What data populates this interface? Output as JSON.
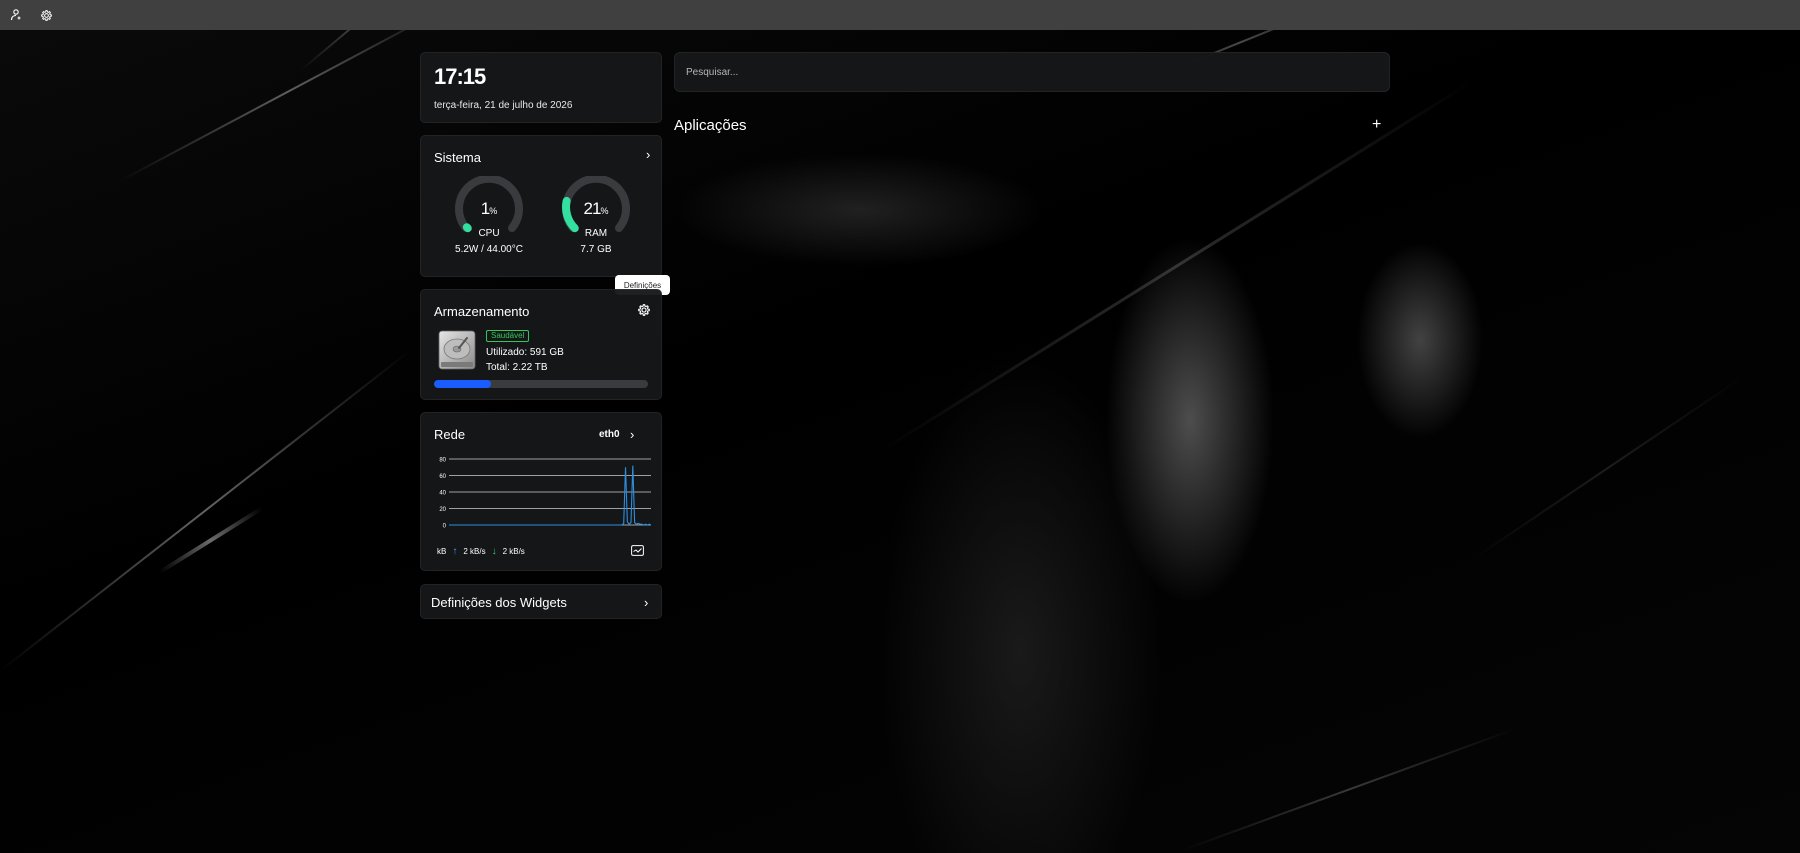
{
  "topbar": {
    "icons": [
      "user-network-icon",
      "gear-icon"
    ]
  },
  "clock": {
    "time": "17:15",
    "date": "terça-feira, 21 de julho de 2026"
  },
  "system": {
    "title": "Sistema",
    "cpu": {
      "value": "1",
      "unit": "%",
      "label": "CPU",
      "detail": "5.2W / 44.00°C",
      "percent": 1
    },
    "ram": {
      "value": "21",
      "unit": "%",
      "label": "RAM",
      "detail": "7.7 GB",
      "percent": 21
    },
    "accent": "#33e0a0"
  },
  "tooltip": {
    "text": "Definições"
  },
  "storage": {
    "title": "Armazenamento",
    "status": "Saudável",
    "used": "Utilizado: 591 GB",
    "total": "Total: 2.22 TB",
    "used_fraction": 0.266,
    "bar_color": "#1a5cff"
  },
  "network": {
    "title": "Rede",
    "interface": "eth0",
    "unit": "kB",
    "upload": "2 kB/s",
    "download": "2 kB/s",
    "chart_data": {
      "type": "line",
      "yticks": [
        "80",
        "60",
        "40",
        "20",
        "0"
      ],
      "ylim": [
        0,
        80
      ],
      "series": [
        {
          "values": [
            0,
            0,
            0,
            0,
            0,
            0,
            0,
            0,
            0,
            0,
            0,
            0,
            0,
            0,
            0,
            0,
            0,
            0,
            0,
            0,
            0,
            0,
            0,
            0,
            0,
            0,
            0,
            0,
            0,
            0,
            0,
            0,
            0,
            0,
            0,
            0,
            0,
            0,
            0,
            0,
            0,
            0,
            0,
            0,
            0,
            0,
            0,
            0,
            0,
            0,
            0,
            0,
            0,
            0,
            0,
            0,
            0,
            0,
            0,
            0,
            0,
            0,
            0,
            0,
            0,
            0,
            0,
            0,
            0,
            0,
            0,
            0,
            0,
            0,
            0,
            0,
            0,
            0,
            0,
            0,
            0,
            0,
            0,
            0,
            0,
            0,
            0,
            0,
            0,
            0,
            0,
            0,
            0,
            0,
            0,
            0,
            2,
            70,
            4,
            1,
            3,
            72,
            3,
            1,
            2,
            1,
            1,
            0,
            1,
            0,
            1,
            0
          ]
        }
      ]
    }
  },
  "widgets": {
    "label": "Definições dos Widgets"
  },
  "search": {
    "placeholder": "Pesquisar..."
  },
  "apps": {
    "title": "Aplicações",
    "add": "+"
  }
}
